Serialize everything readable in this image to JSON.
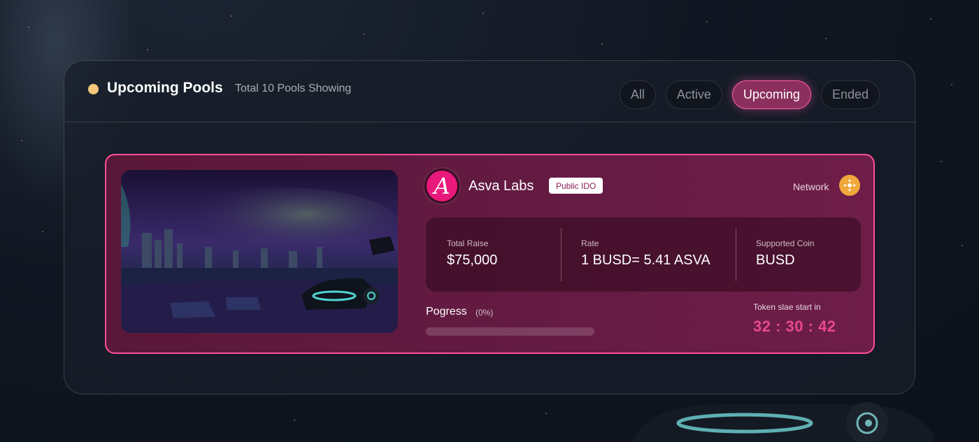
{
  "colors": {
    "accent": "#ff4f9a",
    "status_dot": "#f4c97a",
    "countdown": "#e84a8a",
    "card_bg": "#651b43",
    "network_icon": "#f0a83a"
  },
  "header": {
    "title": "Upcoming Pools",
    "subtitle": "Total 10 Pools Showing",
    "status_icon": "dot-icon"
  },
  "filters": [
    {
      "label": "All",
      "active": false
    },
    {
      "label": "Active",
      "active": false
    },
    {
      "label": "Upcoming",
      "active": true
    },
    {
      "label": "Ended",
      "active": false
    }
  ],
  "pool": {
    "logo_letter": "A",
    "logo_icon": "asva-logo-icon",
    "name": "Asva Labs",
    "badge": "Public IDO",
    "network_label": "Network",
    "network_icon": "bnb-icon",
    "stats": [
      {
        "label": "Total Raise",
        "value": "$75,000"
      },
      {
        "label": "Rate",
        "value": "1 BUSD= 5.41 ASVA"
      },
      {
        "label": "Supported Coin",
        "value": "BUSD"
      }
    ],
    "progress_label": "Pogress",
    "progress_percent_text": "(0%)",
    "progress_value": 0,
    "countdown_label": "Token slae start in",
    "countdown": "32 : 30 : 42"
  }
}
